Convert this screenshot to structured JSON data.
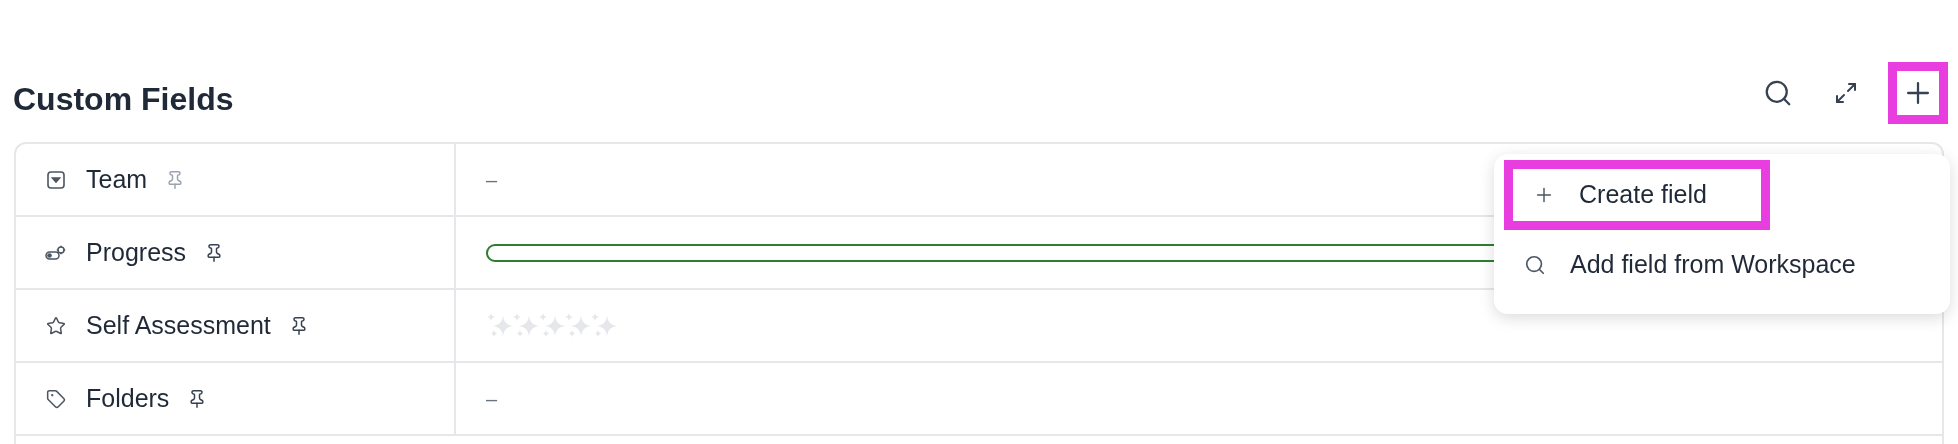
{
  "header": {
    "title": "Custom Fields"
  },
  "toolbar": {
    "add_highlighted": true
  },
  "fields": [
    {
      "name": "Team",
      "pinned": false,
      "kind": "empty",
      "value": "–"
    },
    {
      "name": "Progress",
      "pinned": true,
      "kind": "progress",
      "level": 0
    },
    {
      "name": "Self Assessment",
      "pinned": true,
      "kind": "rating",
      "stars": 0
    },
    {
      "name": "Folders",
      "pinned": true,
      "kind": "empty",
      "value": "–"
    }
  ],
  "menu": {
    "items": [
      {
        "label": "Create field",
        "highlighted": true
      },
      {
        "label": "Add field from Workspace",
        "highlighted": false
      }
    ]
  }
}
